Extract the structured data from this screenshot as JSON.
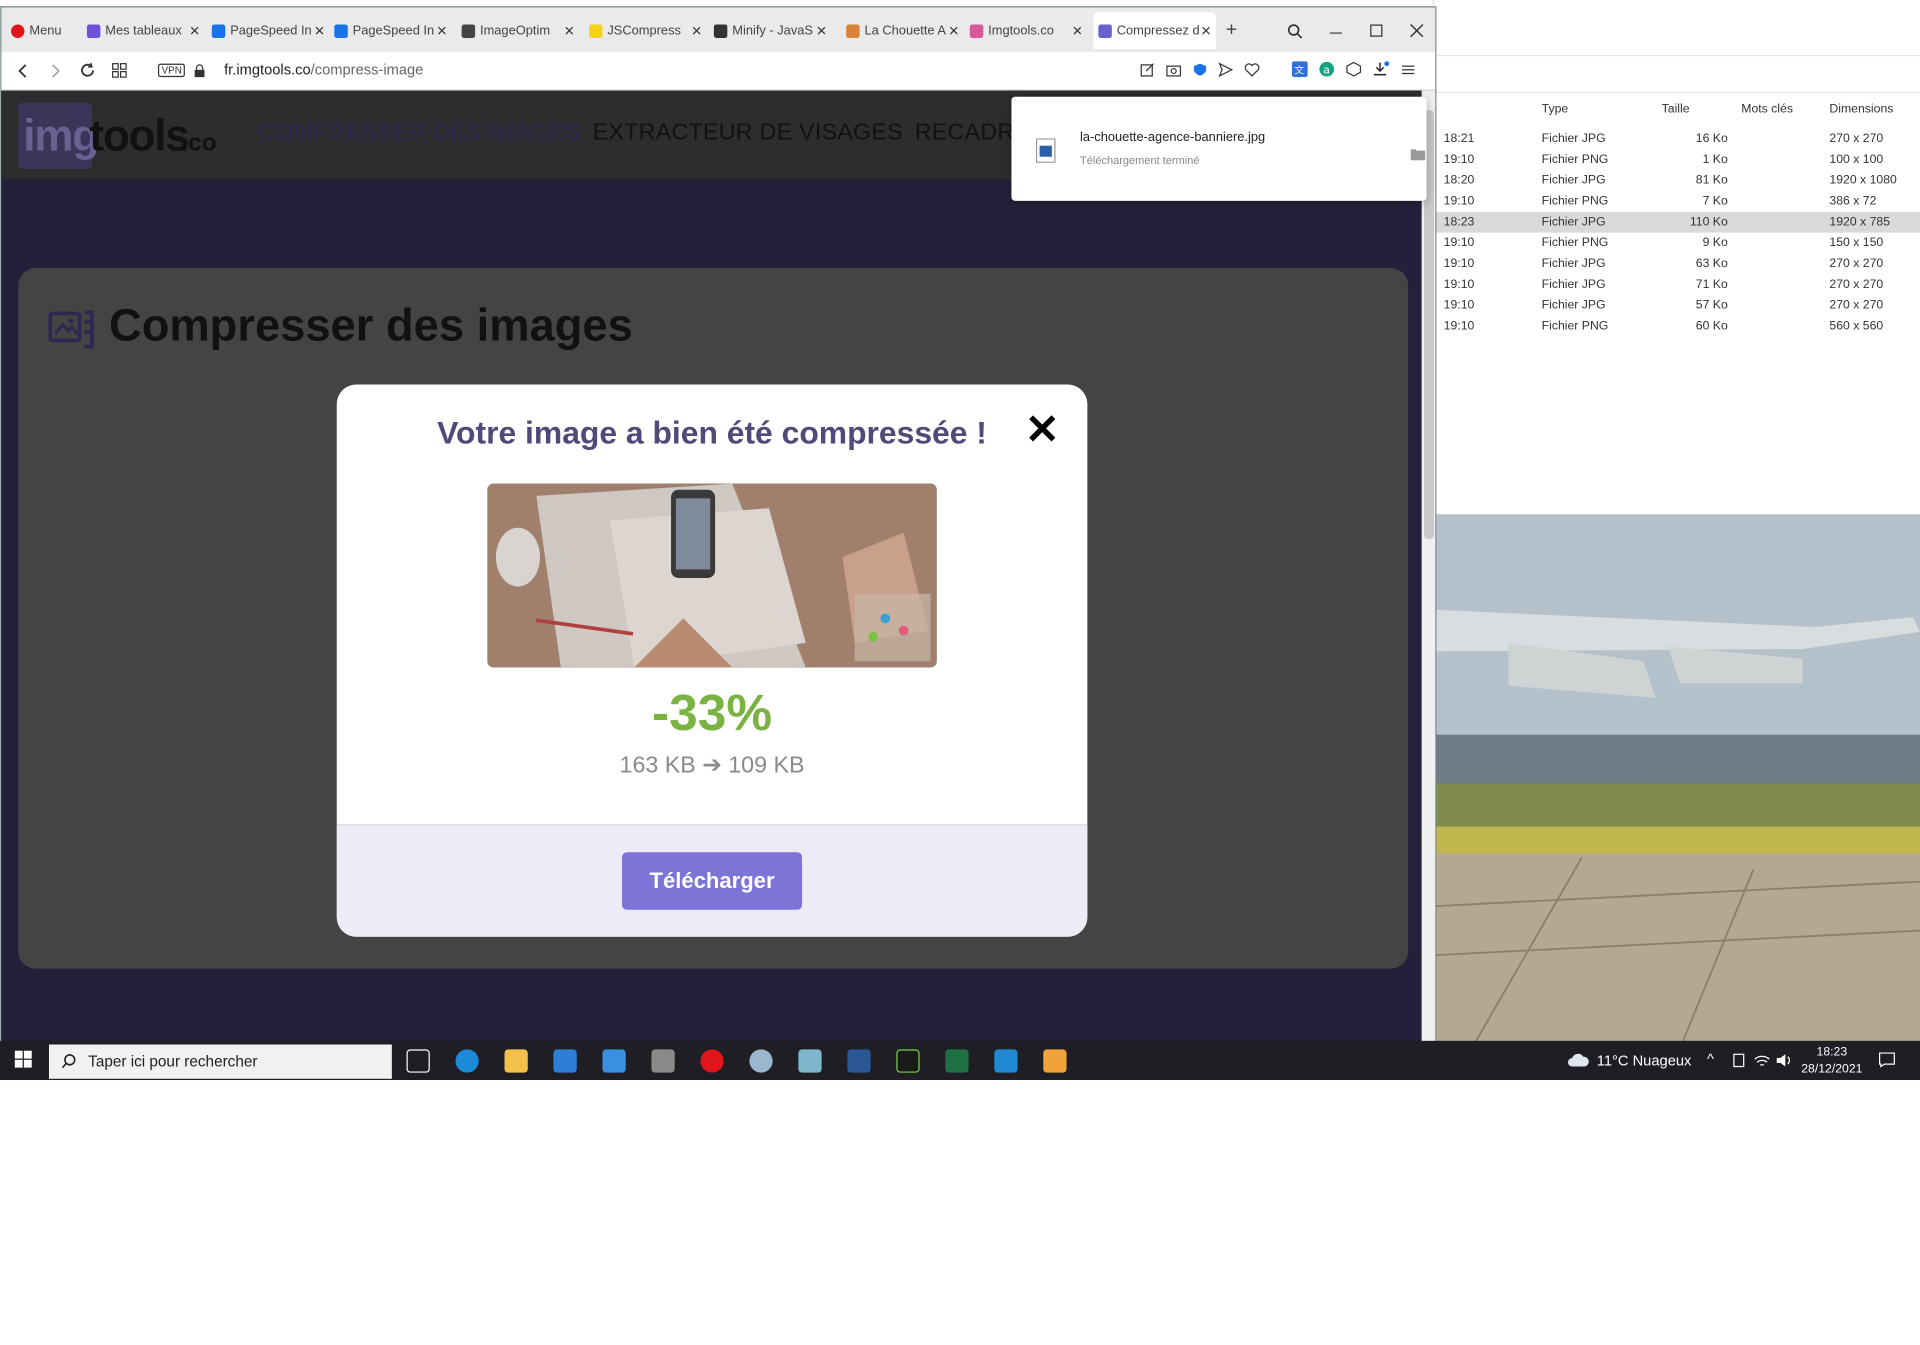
{
  "browser": {
    "menu_label": "Menu",
    "tabs": [
      {
        "label": "Mes tableaux",
        "color": "#6b52d8"
      },
      {
        "label": "PageSpeed In",
        "color": "#1a73e8"
      },
      {
        "label": "PageSpeed In",
        "color": "#1a73e8"
      },
      {
        "label": "ImageOptim",
        "color": "#444444"
      },
      {
        "label": "JSCompress",
        "color": "#f7d21b"
      },
      {
        "label": "Minify - JavaS",
        "color": "#333333"
      },
      {
        "label": "La Chouette A",
        "color": "#d9823a"
      },
      {
        "label": "Imgtools.co",
        "color": "#d45a9b"
      },
      {
        "label": "Compressez d",
        "color": "#6b5fd0",
        "active": true
      }
    ],
    "vpn_label": "VPN",
    "url_host": "fr.imgtools.co",
    "url_path": "/compress-image"
  },
  "download_popup": {
    "filename": "la-chouette-agence-banniere.jpg",
    "status": "Téléchargement terminé"
  },
  "site": {
    "logo_text_main": "img",
    "logo_text_mid": "tools",
    "logo_text_suffix": ".co",
    "nav": [
      {
        "label": "COMPRESSER DES IMAGES",
        "active": true
      },
      {
        "label": "EXTRACTEUR DE VISAGES"
      },
      {
        "label": "RECADRE"
      }
    ],
    "card_title": "Compresser des images"
  },
  "modal": {
    "title": "Votre image a bien été compressée !",
    "close_symbol": "✕",
    "reduction": "-33%",
    "sizes": "163 KB ➔ 109 KB",
    "download_label": "Télécharger"
  },
  "explorer": {
    "columns": [
      "Type",
      "Taille",
      "Mots clés",
      "Dimensions"
    ],
    "rows": [
      {
        "time": "18:21",
        "type": "Fichier JPG",
        "size": "16 Ko",
        "dims": "270 x 270"
      },
      {
        "time": "19:10",
        "type": "Fichier PNG",
        "size": "1 Ko",
        "dims": "100 x 100"
      },
      {
        "time": "18:20",
        "type": "Fichier JPG",
        "size": "81 Ko",
        "dims": "1920 x 1080"
      },
      {
        "time": "19:10",
        "type": "Fichier PNG",
        "size": "7 Ko",
        "dims": "386 x 72"
      },
      {
        "time": "18:23",
        "type": "Fichier JPG",
        "size": "110 Ko",
        "dims": "1920 x 785",
        "selected": true
      },
      {
        "time": "19:10",
        "type": "Fichier PNG",
        "size": "9 Ko",
        "dims": "150 x 150"
      },
      {
        "time": "19:10",
        "type": "Fichier JPG",
        "size": "63 Ko",
        "dims": "270 x 270"
      },
      {
        "time": "19:10",
        "type": "Fichier JPG",
        "size": "71 Ko",
        "dims": "270 x 270"
      },
      {
        "time": "19:10",
        "type": "Fichier JPG",
        "size": "57 Ko",
        "dims": "270 x 270"
      },
      {
        "time": "19:10",
        "type": "Fichier PNG",
        "size": "60 Ko",
        "dims": "560 x 560"
      }
    ]
  },
  "taskbar": {
    "search_placeholder": "Taper ici pour rechercher",
    "weather": "11°C  Nuageux",
    "time": "18:23",
    "date": "28/12/2021"
  }
}
